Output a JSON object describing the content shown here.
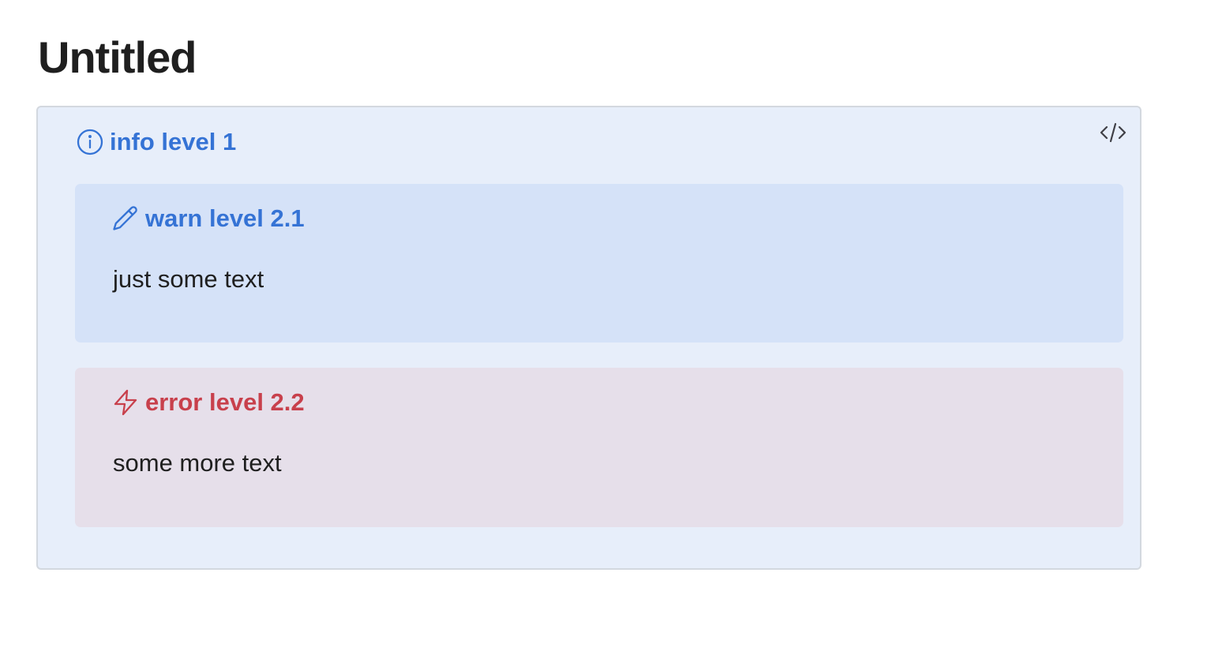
{
  "page": {
    "title": "Untitled"
  },
  "callout": {
    "title": "info level 1",
    "icon": "info-icon",
    "code_toggle_icon": "code-icon",
    "nested": [
      {
        "title": "warn level 2.1",
        "icon": "pencil-icon",
        "body": "just some text"
      },
      {
        "title": "error level 2.2",
        "icon": "lightning-icon",
        "body": "some more text"
      }
    ]
  },
  "colors": {
    "info_accent": "#3573d5",
    "error_accent": "#c8404c",
    "outer_background": "#e7eefa",
    "warn_background": "#d5e2f8",
    "error_background": "#e6dfea"
  }
}
